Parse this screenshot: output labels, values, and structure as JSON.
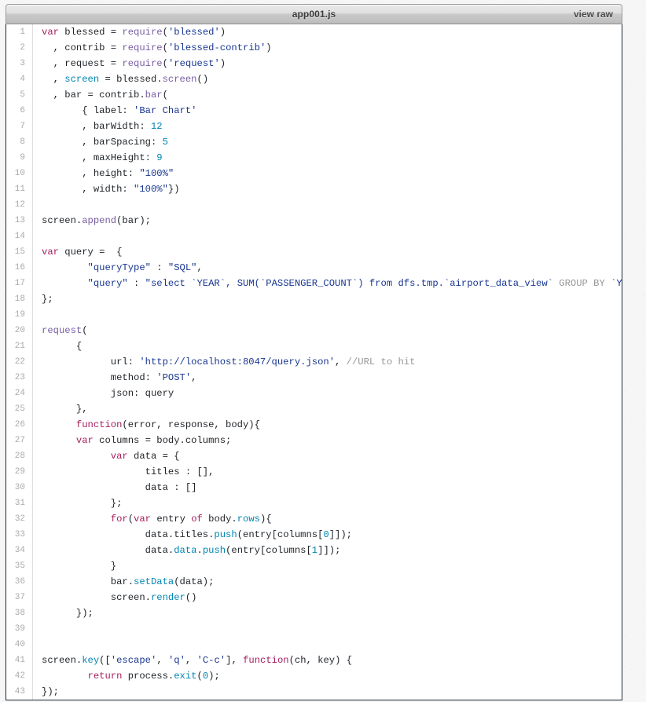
{
  "header": {
    "title": "app001.js",
    "raw_link": "view raw"
  },
  "code": {
    "language": "javascript",
    "first_line_number": 1,
    "line_count": 43,
    "colors": {
      "keyword": "#a71d5d",
      "string": "#183691",
      "number": "#0086b3",
      "function": "#795da3",
      "member": "#0086b3",
      "comment": "#969896",
      "plain": "#1f2328",
      "gutter_text": "#aaaaaa",
      "body_background": "#ffffff",
      "body_border": "#1b2733"
    },
    "lines": [
      {
        "num": "1",
        "text": "var blessed = require('blessed')"
      },
      {
        "num": "2",
        "text": "  , contrib = require('blessed-contrib')"
      },
      {
        "num": "3",
        "text": "  , request = require('request')"
      },
      {
        "num": "4",
        "text": "  , screen = blessed.screen()"
      },
      {
        "num": "5",
        "text": "  , bar = contrib.bar("
      },
      {
        "num": "6",
        "text": "       { label: 'Bar Chart'"
      },
      {
        "num": "7",
        "text": "       , barWidth: 12"
      },
      {
        "num": "8",
        "text": "       , barSpacing: 5"
      },
      {
        "num": "9",
        "text": "       , maxHeight: 9"
      },
      {
        "num": "10",
        "text": "       , height: \"100%\""
      },
      {
        "num": "11",
        "text": "       , width: \"100%\"})"
      },
      {
        "num": "12",
        "text": ""
      },
      {
        "num": "13",
        "text": "screen.append(bar);"
      },
      {
        "num": "14",
        "text": ""
      },
      {
        "num": "15",
        "text": "var query =  {"
      },
      {
        "num": "16",
        "text": "        \"queryType\" : \"SQL\","
      },
      {
        "num": "17",
        "text": "        \"query\" : \"select `YEAR`, SUM(`PASSENGER_COUNT`) from dfs.tmp.`airport_data_view` GROUP BY `YEAR`\""
      },
      {
        "num": "18",
        "text": "};"
      },
      {
        "num": "19",
        "text": ""
      },
      {
        "num": "20",
        "text": "request("
      },
      {
        "num": "21",
        "text": "      {"
      },
      {
        "num": "22",
        "text": "            url: 'http://localhost:8047/query.json', //URL to hit"
      },
      {
        "num": "23",
        "text": "            method: 'POST',"
      },
      {
        "num": "24",
        "text": "            json: query"
      },
      {
        "num": "25",
        "text": "      },"
      },
      {
        "num": "26",
        "text": "      function(error, response, body){"
      },
      {
        "num": "27",
        "text": "      var columns = body.columns;"
      },
      {
        "num": "28",
        "text": "            var data = {"
      },
      {
        "num": "29",
        "text": "                  titles : [],"
      },
      {
        "num": "30",
        "text": "                  data : []"
      },
      {
        "num": "31",
        "text": "            };"
      },
      {
        "num": "32",
        "text": "            for(var entry of body.rows){"
      },
      {
        "num": "33",
        "text": "                  data.titles.push(entry[columns[0]]);"
      },
      {
        "num": "34",
        "text": "                  data.data.push(entry[columns[1]]);"
      },
      {
        "num": "35",
        "text": "            }"
      },
      {
        "num": "36",
        "text": "            bar.setData(data);"
      },
      {
        "num": "37",
        "text": "            screen.render()"
      },
      {
        "num": "38",
        "text": "      });"
      },
      {
        "num": "39",
        "text": ""
      },
      {
        "num": "40",
        "text": ""
      },
      {
        "num": "41",
        "text": "screen.key(['escape', 'q', 'C-c'], function(ch, key) {"
      },
      {
        "num": "42",
        "text": "        return process.exit(0);"
      },
      {
        "num": "43",
        "text": "});"
      }
    ],
    "tokens": [
      [
        [
          "k",
          "var"
        ],
        [
          "p",
          " blessed = "
        ],
        [
          "f",
          "require"
        ],
        [
          "p",
          "("
        ],
        [
          "s",
          "'blessed'"
        ],
        [
          "p",
          ")"
        ]
      ],
      [
        [
          "p",
          "  , contrib = "
        ],
        [
          "f",
          "require"
        ],
        [
          "p",
          "("
        ],
        [
          "s",
          "'blessed-contrib'"
        ],
        [
          "p",
          ")"
        ]
      ],
      [
        [
          "p",
          "  , request = "
        ],
        [
          "f",
          "require"
        ],
        [
          "p",
          "("
        ],
        [
          "s",
          "'request'"
        ],
        [
          "p",
          ")"
        ]
      ],
      [
        [
          "p",
          "  , "
        ],
        [
          "m",
          "screen"
        ],
        [
          "p",
          " = blessed."
        ],
        [
          "f",
          "screen"
        ],
        [
          "p",
          "()"
        ]
      ],
      [
        [
          "p",
          "  , bar = contrib."
        ],
        [
          "f",
          "bar"
        ],
        [
          "p",
          "("
        ]
      ],
      [
        [
          "p",
          "       { label: "
        ],
        [
          "s",
          "'Bar Chart'"
        ]
      ],
      [
        [
          "p",
          "       , barWidth: "
        ],
        [
          "n",
          "12"
        ]
      ],
      [
        [
          "p",
          "       , barSpacing: "
        ],
        [
          "n",
          "5"
        ]
      ],
      [
        [
          "p",
          "       , maxHeight: "
        ],
        [
          "n",
          "9"
        ]
      ],
      [
        [
          "p",
          "       , height: "
        ],
        [
          "s",
          "\"100%\""
        ]
      ],
      [
        [
          "p",
          "       , width: "
        ],
        [
          "s",
          "\"100%\""
        ],
        [
          "p",
          "})"
        ]
      ],
      [
        [
          "p",
          ""
        ]
      ],
      [
        [
          "p",
          "screen."
        ],
        [
          "f",
          "append"
        ],
        [
          "p",
          "(bar);"
        ]
      ],
      [
        [
          "p",
          ""
        ]
      ],
      [
        [
          "k",
          "var"
        ],
        [
          "p",
          " query =  {"
        ]
      ],
      [
        [
          "p",
          "        "
        ],
        [
          "s",
          "\"queryType\""
        ],
        [
          "p",
          " : "
        ],
        [
          "s",
          "\"SQL\""
        ],
        [
          "p",
          ","
        ]
      ],
      [
        [
          "p",
          "        "
        ],
        [
          "s",
          "\"query\""
        ],
        [
          "p",
          " : "
        ],
        [
          "s",
          "\"select `YEAR`, SUM(`PASSENGER_COUNT`) from dfs.tmp.`airport_data_view` "
        ],
        [
          "sqlkw",
          "GROUP BY"
        ],
        [
          "s",
          " `YEAR`\""
        ]
      ],
      [
        [
          "p",
          "};"
        ]
      ],
      [
        [
          "p",
          ""
        ]
      ],
      [
        [
          "f",
          "request"
        ],
        [
          "p",
          "("
        ]
      ],
      [
        [
          "p",
          "      {"
        ]
      ],
      [
        [
          "p",
          "            url: "
        ],
        [
          "s",
          "'http://localhost:8047/query.json'"
        ],
        [
          "p",
          ", "
        ],
        [
          "c",
          "//URL to hit"
        ]
      ],
      [
        [
          "p",
          "            method: "
        ],
        [
          "s",
          "'POST'"
        ],
        [
          "p",
          ","
        ]
      ],
      [
        [
          "p",
          "            json: query"
        ]
      ],
      [
        [
          "p",
          "      },"
        ]
      ],
      [
        [
          "p",
          "      "
        ],
        [
          "k",
          "function"
        ],
        [
          "p",
          "(error, response, body){"
        ]
      ],
      [
        [
          "p",
          "      "
        ],
        [
          "k",
          "var"
        ],
        [
          "p",
          " columns = body.columns;"
        ]
      ],
      [
        [
          "p",
          "            "
        ],
        [
          "k",
          "var"
        ],
        [
          "p",
          " data = {"
        ]
      ],
      [
        [
          "p",
          "                  titles : [],"
        ]
      ],
      [
        [
          "p",
          "                  data : []"
        ]
      ],
      [
        [
          "p",
          "            };"
        ]
      ],
      [
        [
          "p",
          "            "
        ],
        [
          "k",
          "for"
        ],
        [
          "p",
          "("
        ],
        [
          "k",
          "var"
        ],
        [
          "p",
          " entry "
        ],
        [
          "k",
          "of"
        ],
        [
          "p",
          " body."
        ],
        [
          "m",
          "rows"
        ],
        [
          "p",
          "){"
        ]
      ],
      [
        [
          "p",
          "                  data.titles."
        ],
        [
          "m",
          "push"
        ],
        [
          "p",
          "(entry[columns["
        ],
        [
          "n",
          "0"
        ],
        [
          "p",
          "]]);"
        ]
      ],
      [
        [
          "p",
          "                  data."
        ],
        [
          "m",
          "data"
        ],
        [
          "p",
          "."
        ],
        [
          "m",
          "push"
        ],
        [
          "p",
          "(entry[columns["
        ],
        [
          "n",
          "1"
        ],
        [
          "p",
          "]]);"
        ]
      ],
      [
        [
          "p",
          "            }"
        ]
      ],
      [
        [
          "p",
          "            bar."
        ],
        [
          "m",
          "setData"
        ],
        [
          "p",
          "(data);"
        ]
      ],
      [
        [
          "p",
          "            screen."
        ],
        [
          "m",
          "render"
        ],
        [
          "p",
          "()"
        ]
      ],
      [
        [
          "p",
          "      });"
        ]
      ],
      [
        [
          "p",
          ""
        ]
      ],
      [
        [
          "p",
          ""
        ]
      ],
      [
        [
          "p",
          "screen."
        ],
        [
          "m",
          "key"
        ],
        [
          "p",
          "(["
        ],
        [
          "s",
          "'escape'"
        ],
        [
          "p",
          ", "
        ],
        [
          "s",
          "'q'"
        ],
        [
          "p",
          ", "
        ],
        [
          "s",
          "'C-c'"
        ],
        [
          "p",
          "], "
        ],
        [
          "k",
          "function"
        ],
        [
          "p",
          "(ch, key) {"
        ]
      ],
      [
        [
          "p",
          "        "
        ],
        [
          "k",
          "return"
        ],
        [
          "p",
          " process."
        ],
        [
          "m",
          "exit"
        ],
        [
          "p",
          "("
        ],
        [
          "n",
          "0"
        ],
        [
          "p",
          ");"
        ]
      ]
    ]
  }
}
